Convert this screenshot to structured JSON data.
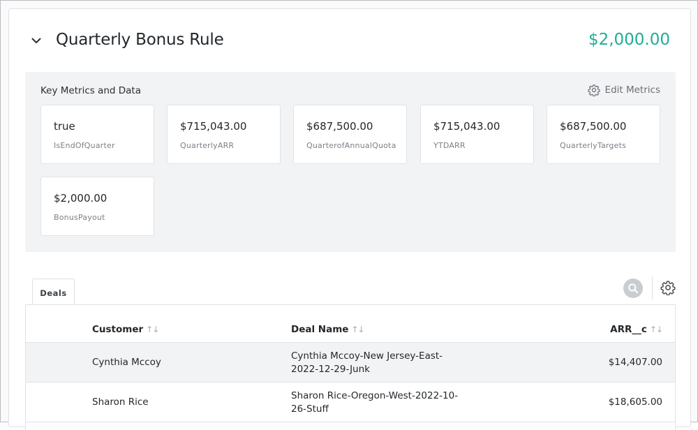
{
  "rule": {
    "title": "Quarterly Bonus Rule",
    "amount": "$2,000.00",
    "amount_color": "#1fae94"
  },
  "metrics": {
    "title": "Key Metrics and Data",
    "edit_label": "Edit Metrics",
    "items": [
      {
        "value": "true",
        "label": "IsEndOfQuarter"
      },
      {
        "value": "$715,043.00",
        "label": "QuarterlyARR"
      },
      {
        "value": "$687,500.00",
        "label": "QuarterofAnnualQuota"
      },
      {
        "value": "$715,043.00",
        "label": "YTDARR"
      },
      {
        "value": "$687,500.00",
        "label": "QuarterlyTargets"
      },
      {
        "value": "$2,000.00",
        "label": "BonusPayout"
      }
    ]
  },
  "tabs": [
    {
      "label": "Deals"
    }
  ],
  "table": {
    "columns": [
      {
        "label": "Customer",
        "sort_icon": "↑↓"
      },
      {
        "label": "Deal Name",
        "sort_icon": "↑↓"
      },
      {
        "label": "ARR__c",
        "sort_icon": "↑↓"
      }
    ],
    "rows": [
      {
        "customer": "Cynthia Mccoy",
        "deal_name": "Cynthia Mccoy-New Jersey-East-2022-12-29-Junk",
        "arr": "$14,407.00"
      },
      {
        "customer": "Sharon Rice",
        "deal_name": "Sharon Rice-Oregon-West-2022-10-26-Stuff",
        "arr": "$18,605.00"
      }
    ]
  },
  "icons": {
    "collapse": "chevron-down-icon",
    "edit_metrics": "gear-icon",
    "search": "search-icon",
    "table_settings": "gear-icon"
  }
}
